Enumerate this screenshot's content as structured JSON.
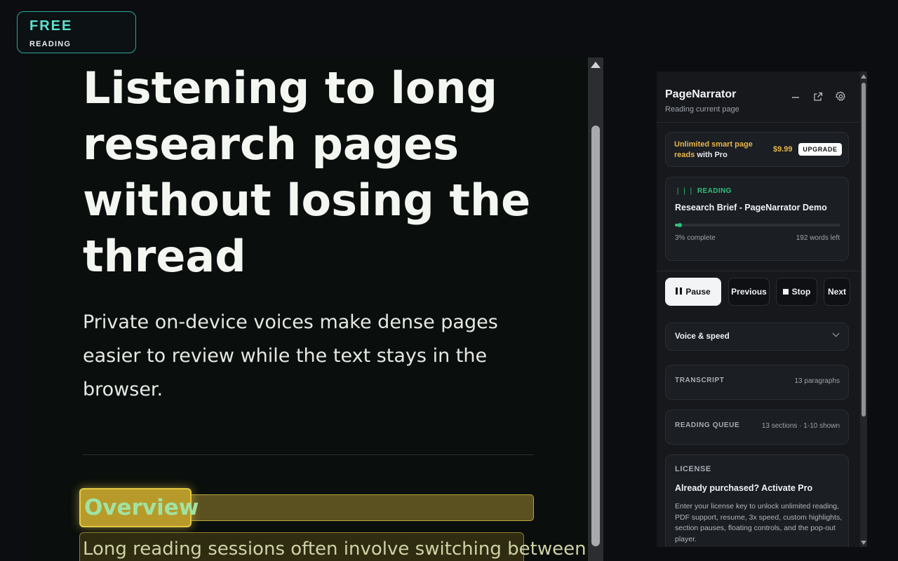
{
  "badge": {
    "plan": "FREE",
    "label": "READING"
  },
  "article": {
    "headline": "Listening to long research pages without losing the thread",
    "lede": "Private on-device voices make dense pages easier to review while the text stays in the browser.",
    "section_heading": "Overview",
    "paragraph_start": "Long reading sessions often involve switching between"
  },
  "panel": {
    "title": "PageNarrator",
    "subtitle": "Reading current page",
    "header_icons": [
      "minimize-icon",
      "pop-out-icon",
      "gear-icon"
    ],
    "upsell": {
      "highlight": "Unlimited smart page reads",
      "rest": " with Pro",
      "price": "$9.99",
      "button": "UPGRADE"
    },
    "reading": {
      "status": "READING",
      "title": "Research Brief - PageNarrator Demo",
      "progress_percent": 3,
      "progress_label": "3% complete",
      "words_left": "192 words left"
    },
    "controls": {
      "pause": "Pause",
      "previous": "Previous",
      "stop": "Stop",
      "next": "Next"
    },
    "voice_speed": "Voice & speed",
    "transcript": {
      "label": "TRANSCRIPT",
      "meta": "13 paragraphs"
    },
    "queue": {
      "label": "READING QUEUE",
      "meta": "13 sections · 1-10 shown"
    },
    "license": {
      "label": "LICENSE",
      "title": "Already purchased? Activate Pro",
      "desc": "Enter your license key to unlock unlimited reading, PDF support, resume, 3x speed, custom highlights, section pauses, floating controls, and the pop-out player."
    }
  },
  "colors": {
    "accent_green": "#2ec07a",
    "accent_gold": "#e8b54a",
    "badge_teal": "#5fe0cc",
    "highlight_yellow": "#e3c845"
  }
}
